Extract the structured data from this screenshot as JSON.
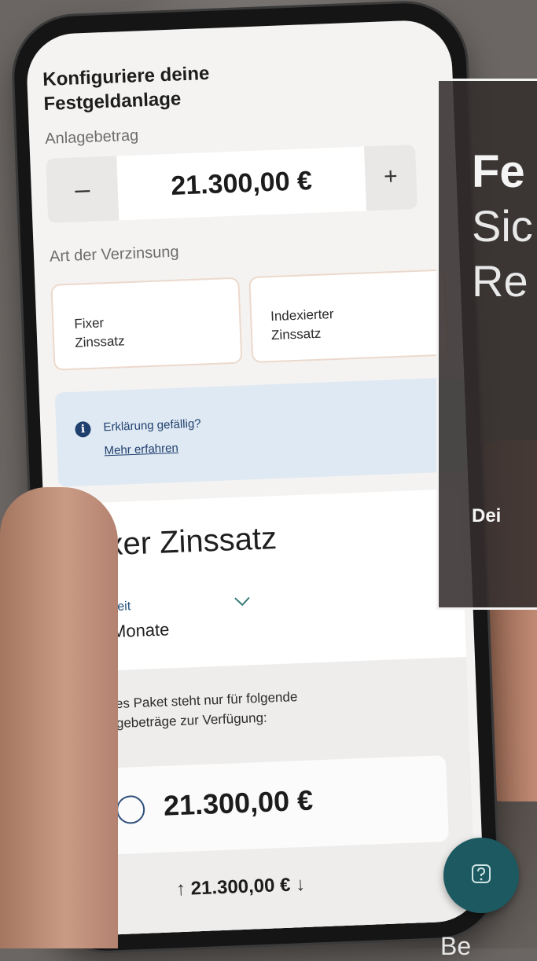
{
  "app": {
    "header_line1": "Konfiguriere deine",
    "header_line2": "Festgeldanlage"
  },
  "amount": {
    "label": "Anlagebetrag",
    "minus": "–",
    "value": "21.300,00 €",
    "plus": "+"
  },
  "interest": {
    "label": "Art der Verzinsung",
    "options": [
      {
        "line1": "Fixer",
        "line2": "Zinssatz"
      },
      {
        "line1": "Indexierter",
        "line2": "Zinssatz"
      }
    ]
  },
  "info": {
    "icon": "info-icon",
    "question": "Erklärung gefällig?",
    "link": "Mehr erfahren"
  },
  "card": {
    "title": "Fixer Zinssatz",
    "term_label": "Laufzeit",
    "term_value": "24 Monate",
    "notice_line1": "Dieses Paket steht nur für folgende",
    "notice_line2": "Anlagebeträge zur Verfügung:",
    "package_value": "21.300,00 €",
    "sort_up": "↑",
    "sort_value": "21.300,00 €",
    "sort_down": "↓"
  },
  "help": {
    "icon": "question-mark-icon"
  },
  "banner": {
    "line1": "Fe",
    "line2": "Sic",
    "line3": "Re",
    "line4": "Dei"
  },
  "bottom_text": "Be",
  "colors": {
    "help_button": "#1d5960",
    "info_box": "#dfe9f3",
    "link": "#1f3f6e",
    "option_border": "#ecd9cd"
  }
}
